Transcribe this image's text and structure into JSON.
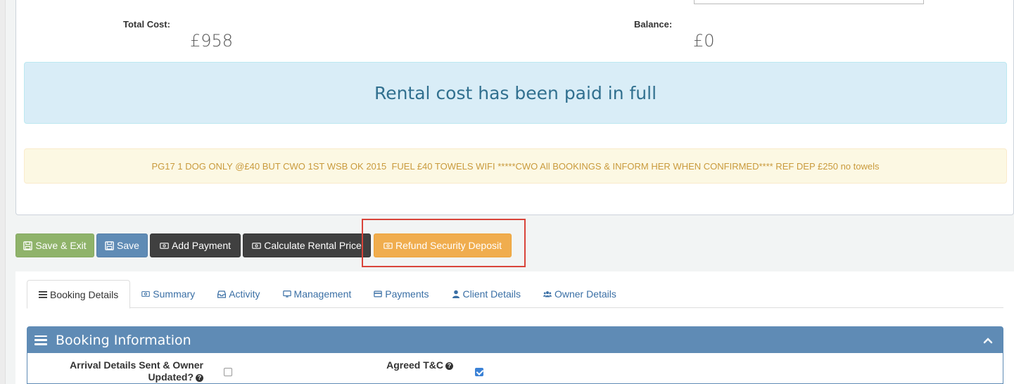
{
  "summary": {
    "total_cost_label": "Total Cost:",
    "total_cost_value": "£958",
    "balance_label": "Balance:",
    "balance_value": "£0"
  },
  "alerts": {
    "paid_message": "Rental cost has been paid in full",
    "notes": "PG17 1 DOG ONLY @£40 BUT CWO 1ST WSB OK 2015  FUEL £40 TOWELS WIFI *****CWO All BOOKINGS & INFORM HER WHEN CONFIRMED**** REF DEP £250 no towels"
  },
  "toolbar": {
    "save_exit_label": "Save & Exit",
    "save_label": "Save",
    "add_payment_label": "Add Payment",
    "calc_price_label": "Calculate Rental Price",
    "refund_deposit_label": "Refund Security Deposit"
  },
  "tabs": [
    {
      "label": "Booking Details",
      "icon": "list-icon",
      "active": true
    },
    {
      "label": "Summary",
      "icon": "money-icon"
    },
    {
      "label": "Activity",
      "icon": "inbox-icon"
    },
    {
      "label": "Management",
      "icon": "monitor-icon"
    },
    {
      "label": "Payments",
      "icon": "credit-card-icon"
    },
    {
      "label": "Client Details",
      "icon": "user-icon"
    },
    {
      "label": "Owner Details",
      "icon": "users-icon"
    }
  ],
  "section": {
    "title": "Booking Information",
    "fields": {
      "arrival_details_label_1": "Arrival Details Sent & Owner",
      "arrival_details_label_2": "Updated?",
      "arrival_details_checked": false,
      "agreed_tc_label": "Agreed T&C",
      "agreed_tc_checked": true
    }
  },
  "colors": {
    "primary": "#5f8bb5",
    "success": "#8fb36a",
    "warning": "#f0ad4e",
    "dark": "#404040",
    "highlight": "#d9443a"
  }
}
